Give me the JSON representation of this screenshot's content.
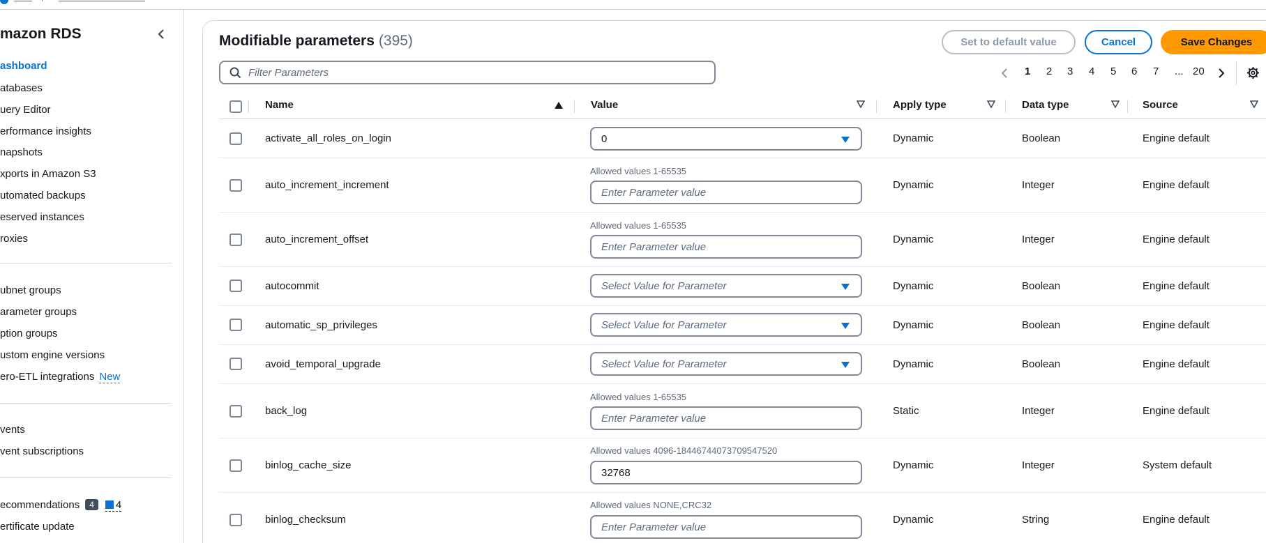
{
  "sidebar": {
    "title": "mazon RDS",
    "items": [
      {
        "label": "ashboard",
        "active": true
      },
      {
        "label": "atabases"
      },
      {
        "label": "uery Editor"
      },
      {
        "label": "erformance insights"
      },
      {
        "label": "napshots"
      },
      {
        "label": "xports in Amazon S3"
      },
      {
        "label": "utomated backups"
      },
      {
        "label": "eserved instances"
      },
      {
        "label": "roxies"
      },
      {
        "label": "ubnet groups"
      },
      {
        "label": "arameter groups"
      },
      {
        "label": "ption groups"
      },
      {
        "label": "ustom engine versions"
      },
      {
        "label": "ero-ETL integrations",
        "badge": "New"
      },
      {
        "label": "vents"
      },
      {
        "label": "vent subscriptions"
      },
      {
        "label": "ecommendations",
        "count": "4",
        "info_count": "4"
      },
      {
        "label": "ertificate update"
      }
    ]
  },
  "header": {
    "title": "Modifiable parameters",
    "count": "(395)",
    "set_default_label": "Set to default value",
    "cancel_label": "Cancel",
    "save_label": "Save Changes"
  },
  "filter": {
    "placeholder": "Filter Parameters"
  },
  "pagination": {
    "pages": [
      "1",
      "2",
      "3",
      "4",
      "5",
      "6",
      "7",
      "...",
      "20"
    ],
    "current": "1"
  },
  "table": {
    "columns": {
      "name": "Name",
      "value": "Value",
      "apply_type": "Apply type",
      "data_type": "Data type",
      "source": "Source"
    },
    "rows": [
      {
        "name": "activate_all_roles_on_login",
        "allowed": "",
        "value": "0",
        "kind": "select",
        "placeholder": "",
        "apply_type": "Dynamic",
        "data_type": "Boolean",
        "source": "Engine default"
      },
      {
        "name": "auto_increment_increment",
        "allowed": "Allowed values 1-65535",
        "value": "",
        "kind": "input",
        "placeholder": "Enter Parameter value",
        "apply_type": "Dynamic",
        "data_type": "Integer",
        "source": "Engine default"
      },
      {
        "name": "auto_increment_offset",
        "allowed": "Allowed values 1-65535",
        "value": "",
        "kind": "input",
        "placeholder": "Enter Parameter value",
        "apply_type": "Dynamic",
        "data_type": "Integer",
        "source": "Engine default"
      },
      {
        "name": "autocommit",
        "allowed": "",
        "value": "",
        "kind": "select",
        "placeholder": "Select Value for Parameter",
        "apply_type": "Dynamic",
        "data_type": "Boolean",
        "source": "Engine default"
      },
      {
        "name": "automatic_sp_privileges",
        "allowed": "",
        "value": "",
        "kind": "select",
        "placeholder": "Select Value for Parameter",
        "apply_type": "Dynamic",
        "data_type": "Boolean",
        "source": "Engine default"
      },
      {
        "name": "avoid_temporal_upgrade",
        "allowed": "",
        "value": "",
        "kind": "select",
        "placeholder": "Select Value for Parameter",
        "apply_type": "Dynamic",
        "data_type": "Boolean",
        "source": "Engine default"
      },
      {
        "name": "back_log",
        "allowed": "Allowed values 1-65535",
        "value": "",
        "kind": "input",
        "placeholder": "Enter Parameter value",
        "apply_type": "Static",
        "data_type": "Integer",
        "source": "Engine default"
      },
      {
        "name": "binlog_cache_size",
        "allowed": "Allowed values 4096-18446744073709547520",
        "value": "32768",
        "kind": "input",
        "placeholder": "",
        "apply_type": "Dynamic",
        "data_type": "Integer",
        "source": "System default"
      },
      {
        "name": "binlog_checksum",
        "allowed": "Allowed values NONE,CRC32",
        "value": "",
        "kind": "input",
        "placeholder": "Enter Parameter value",
        "apply_type": "Dynamic",
        "data_type": "String",
        "source": "Engine default"
      }
    ]
  },
  "colors": {
    "accent": "#0972d3",
    "primary_button": "#ff9900",
    "text": "#16191f",
    "muted": "#5f6b7a"
  }
}
